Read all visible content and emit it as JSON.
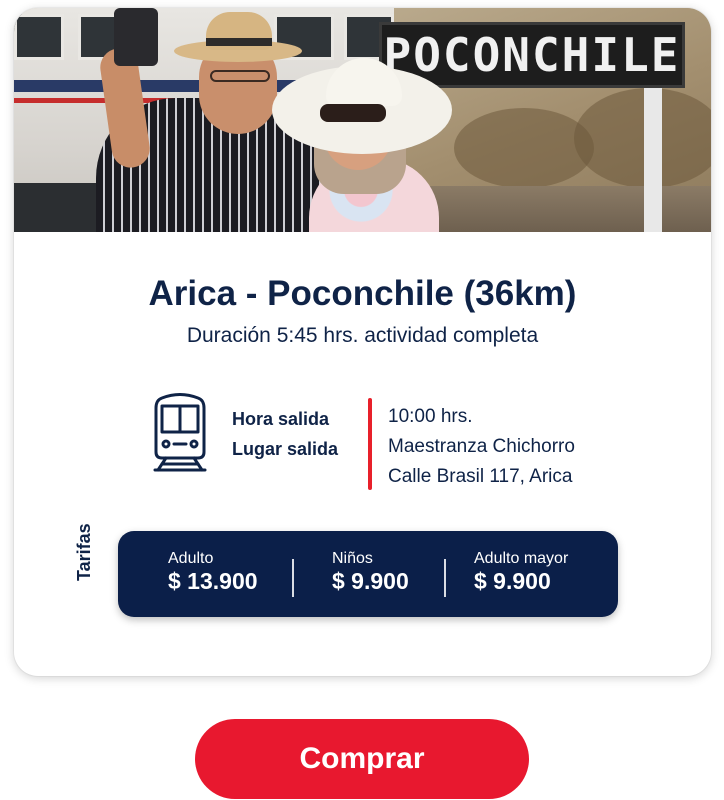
{
  "hero": {
    "sign_text": "POCONCHILE"
  },
  "trip": {
    "title": "Arica - Poconchile (36km)",
    "subtitle": "Duración 5:45 hrs. actividad completa"
  },
  "details": {
    "labels": [
      "Hora salida",
      "Lugar salida"
    ],
    "values": [
      "10:00 hrs.",
      "Maestranza Chichorro",
      "Calle Brasil 117, Arica"
    ]
  },
  "tarifas": {
    "label": "Tarifas",
    "items": [
      {
        "name": "Adulto",
        "price": "$ 13.900"
      },
      {
        "name": "Niños",
        "price": "$ 9.900"
      },
      {
        "name": "Adulto mayor",
        "price": "$ 9.900"
      }
    ]
  },
  "actions": {
    "buy_label": "Comprar"
  },
  "colors": {
    "navy": "#0f2347",
    "price_box": "#0b1f49",
    "accent_red": "#e8182f"
  },
  "icons": {
    "departure": "train-icon"
  }
}
